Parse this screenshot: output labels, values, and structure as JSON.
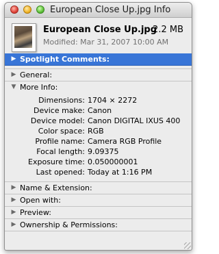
{
  "window": {
    "title": "European Close Up.jpg Info"
  },
  "file": {
    "name": "European Close Up.jpg",
    "size": "2.2 MB",
    "modified": "Modified: Mar 31, 2007 10:00 AM"
  },
  "sections": {
    "spotlight": "Spotlight Comments:",
    "general": "General:",
    "more_info": "More Info:",
    "name_extension": "Name & Extension:",
    "open_with": "Open with:",
    "preview": "Preview:",
    "ownership": "Ownership & Permissions:"
  },
  "more_info": [
    {
      "label": "Dimensions:",
      "value": "1704 × 2272"
    },
    {
      "label": "Device make:",
      "value": "Canon"
    },
    {
      "label": "Device model:",
      "value": "Canon DIGITAL IXUS 400"
    },
    {
      "label": "Color space:",
      "value": "RGB"
    },
    {
      "label": "Profile name:",
      "value": "Camera RGB Profile"
    },
    {
      "label": "Focal length:",
      "value": "9.09375"
    },
    {
      "label": "Exposure time:",
      "value": "0.050000001"
    },
    {
      "label": "Last opened:",
      "value": "Today at 1:16 PM"
    }
  ],
  "icons": {
    "collapsed": "▶",
    "expanded": "▼"
  },
  "colors": {
    "selection": "#3875d7"
  }
}
